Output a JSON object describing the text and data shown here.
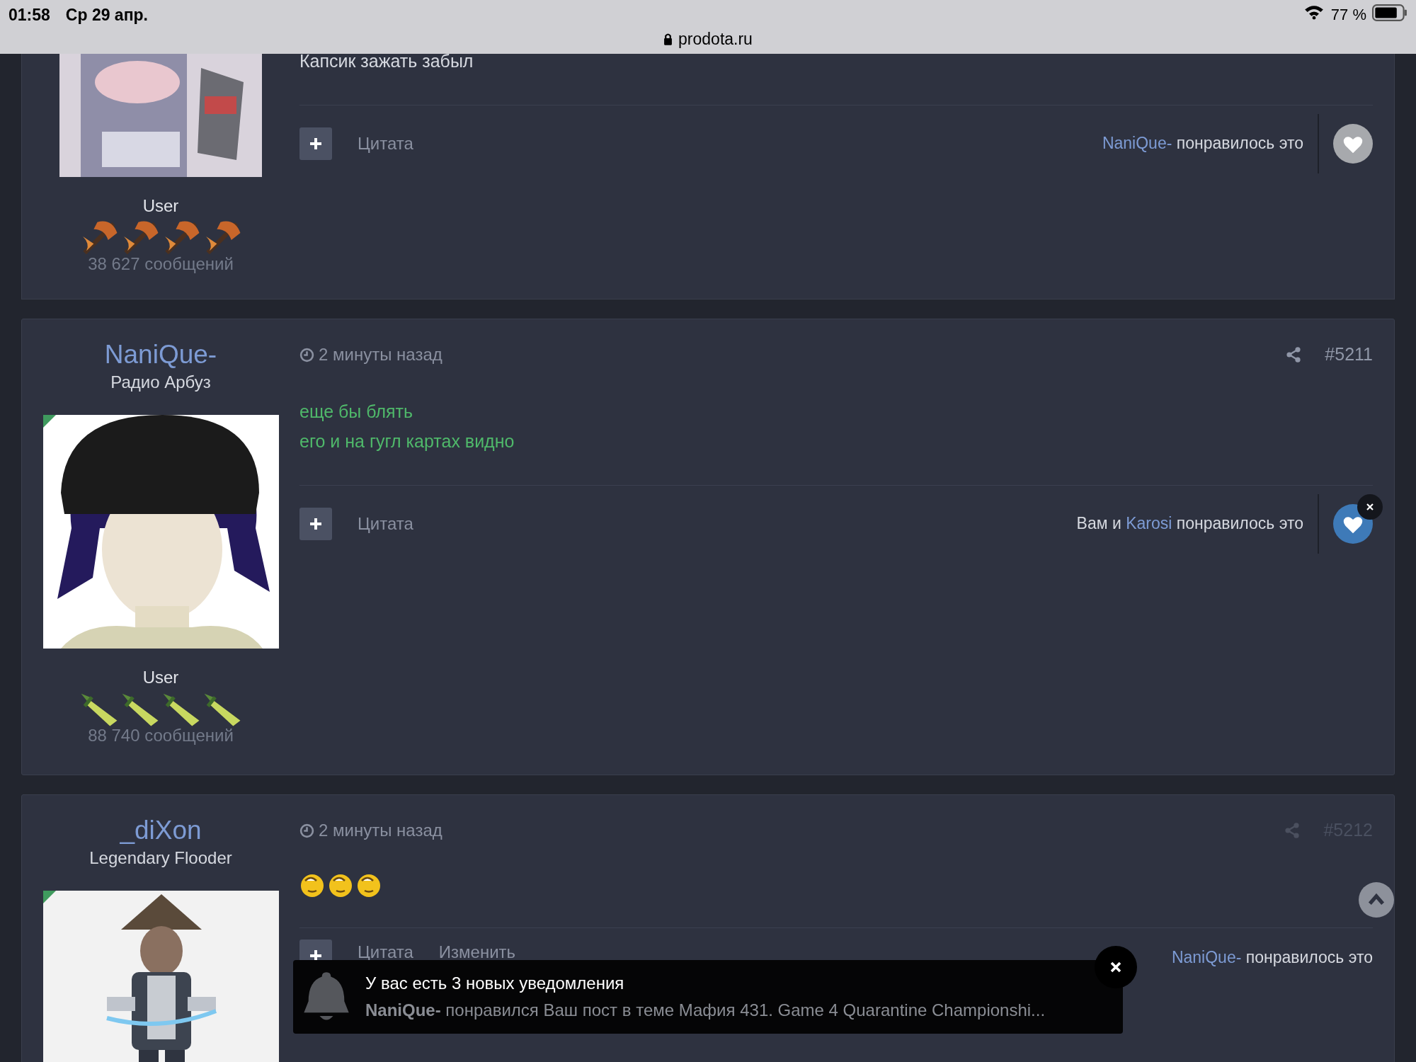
{
  "status_bar": {
    "time": "01:58",
    "date": "Ср 29 апр.",
    "url": "prodota.ru",
    "battery": "77 %"
  },
  "posts": [
    {
      "kind": "cut",
      "rank": "User",
      "rank_icons": [
        {
          "kind": "axe"
        },
        {
          "kind": "axe"
        },
        {
          "kind": "axe"
        },
        {
          "kind": "axe"
        }
      ],
      "message_count": "38 627 сообщений",
      "lines": [
        "Капсик зажать забыл"
      ],
      "actions": [
        "Цитата"
      ],
      "likes": [
        {
          "text": "NaniQue-",
          "kind": "link"
        },
        {
          "text": " понравилось это",
          "kind": "text"
        }
      ],
      "like_button": {
        "liked": false
      }
    },
    {
      "kind": "full",
      "author": "NaniQue-",
      "title": "Радио Арбуз",
      "time": "2 минуты назад",
      "number": "#5211",
      "faded": false,
      "rank": "User",
      "rank_icons": [
        {
          "kind": "dagger"
        },
        {
          "kind": "dagger"
        },
        {
          "kind": "dagger"
        },
        {
          "kind": "dagger"
        }
      ],
      "message_count": "88 740 сообщений",
      "lines": [
        "еще бы блять",
        "его и на гугл картах видно"
      ],
      "actions": [
        "Цитата"
      ],
      "likes": [
        {
          "text": "Вам и ",
          "kind": "text"
        },
        {
          "text": "Karosi",
          "kind": "link"
        },
        {
          "text": " понравилось это",
          "kind": "text"
        }
      ],
      "like_button": {
        "liked": true
      }
    },
    {
      "kind": "full",
      "author": "_diXon",
      "title": "Legendary Flooder",
      "time": "2 минуты назад",
      "number": "#5212",
      "faded": true,
      "emojis": [
        {
          "kind": "smile"
        },
        {
          "kind": "smile"
        },
        {
          "kind": "smile"
        }
      ],
      "actions": [
        "Цитата",
        "Изменить"
      ],
      "likes": [
        {
          "text": "NaniQue-",
          "kind": "link"
        },
        {
          "text": " понравилось это",
          "kind": "text"
        }
      ]
    }
  ],
  "notification": {
    "title": "У вас есть 3 новых уведомления",
    "user": "NaniQue-",
    "text": " понравился Ваш пост в теме Мафия 431. Game 4 Quarantine Championshi..."
  }
}
